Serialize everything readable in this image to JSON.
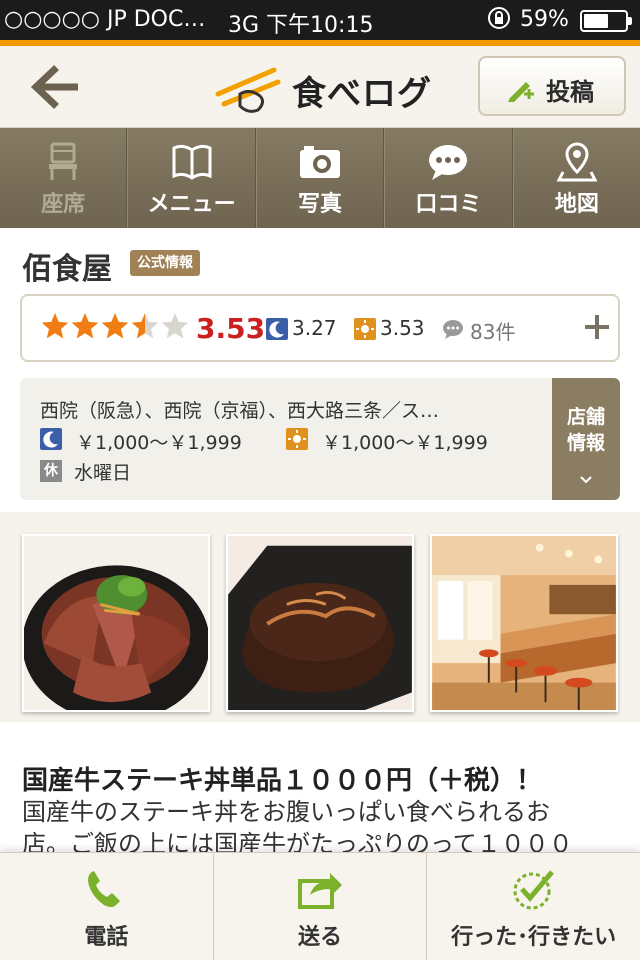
{
  "status_bar": {
    "carrier": "○○○○○ JP DOC…",
    "network_time": "3G 下午10:15",
    "battery": "59%",
    "battery_level": 0.59
  },
  "header": {
    "logo_text": "食べログ",
    "post_label": "投稿"
  },
  "tabs": [
    {
      "label": "座席",
      "icon": "seat-icon",
      "enabled": false
    },
    {
      "label": "メニュー",
      "icon": "book-icon",
      "enabled": true
    },
    {
      "label": "写真",
      "icon": "camera-icon",
      "enabled": true
    },
    {
      "label": "口コミ",
      "icon": "speech-bubble-icon",
      "enabled": true
    },
    {
      "label": "地図",
      "icon": "map-pin-icon",
      "enabled": true
    }
  ],
  "restaurant": {
    "name": "佰食屋",
    "official_badge": "公式情報"
  },
  "rating": {
    "stars": 3.5,
    "score": "3.53",
    "dinner_score": "3.27",
    "lunch_score": "3.53",
    "reviews": "83件"
  },
  "info": {
    "stations": "西院（阪急）、西院（京福）、西大路三条／ス…",
    "dinner_price": "￥1,000～￥1,999",
    "lunch_price": "￥1,000～￥1,999",
    "holiday_badge": "休",
    "holiday": "水曜日",
    "side_label_1": "店舗",
    "side_label_2": "情報"
  },
  "article": {
    "title": "国産牛ステーキ丼単品１０００円（＋税）！",
    "body_line1": "国産牛のステーキ丼をお腹いっぱい食べられるお",
    "body_line2": "店。ご飯の上には国産牛がたっぷりのって１０００"
  },
  "bottom_bar": [
    {
      "label": "電話",
      "icon": "phone-icon"
    },
    {
      "label": "送る",
      "icon": "share-icon"
    },
    {
      "label": "行った･行きたい",
      "icon": "check-circle-icon"
    }
  ],
  "colors": {
    "accent_orange": "#f29800",
    "tab_brown": "#7a6f59",
    "score_red": "#cc1f1f",
    "icon_green": "#6aa51e"
  }
}
